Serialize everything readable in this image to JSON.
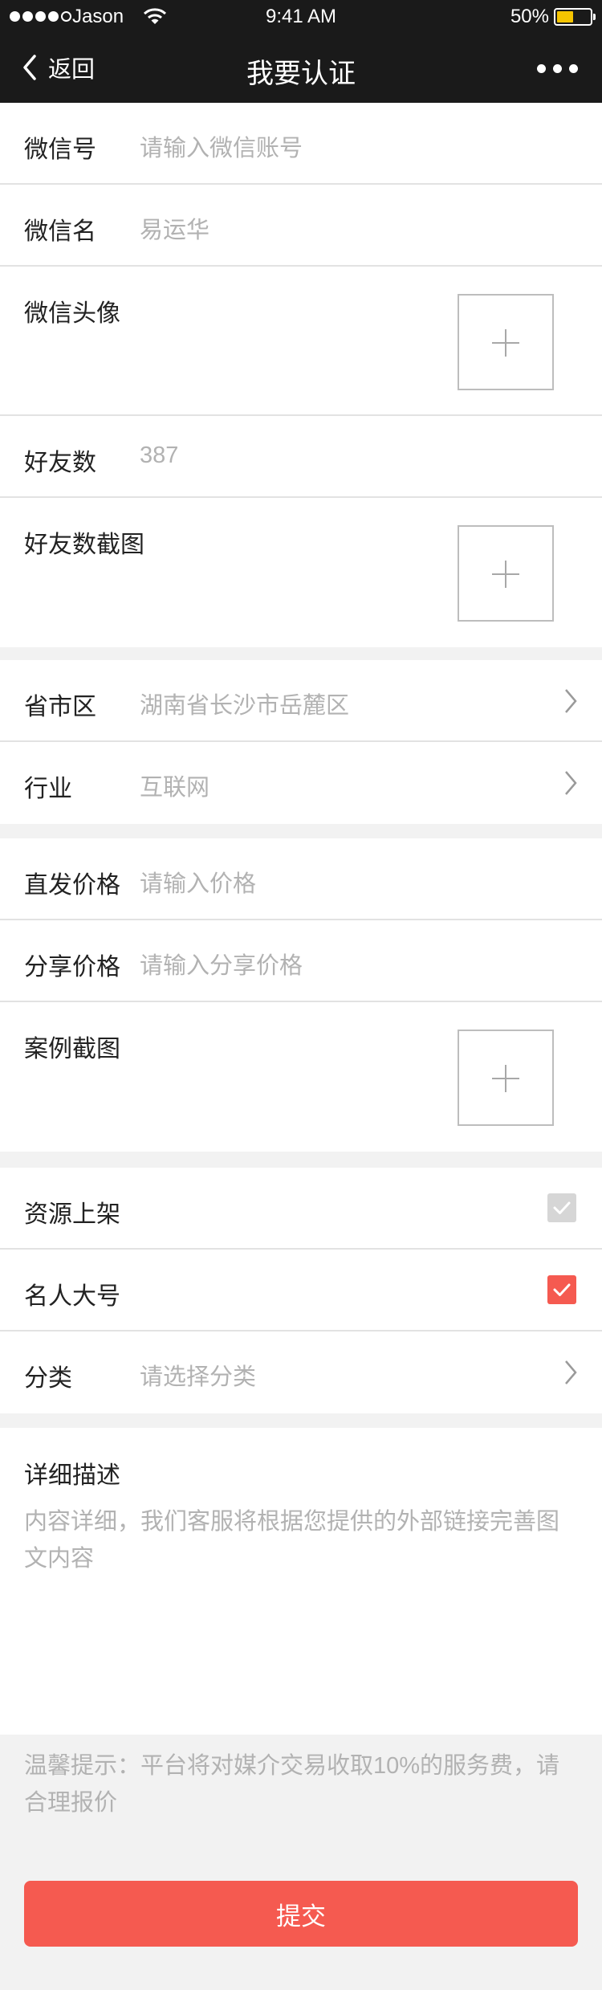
{
  "status_bar": {
    "carrier": "Jason",
    "time": "9:41 AM",
    "battery_pct": "50%",
    "battery_level": 0.5,
    "battery_color": "#f5c400",
    "signal_icons": [
      "signal-dot-icon",
      "wifi-icon",
      "battery-icon"
    ]
  },
  "nav": {
    "back_label": "返回",
    "title": "我要认证",
    "icons": [
      "chevron-left-icon",
      "more-icon"
    ]
  },
  "form": {
    "wechat_id": {
      "label": "微信号",
      "placeholder": "请输入微信账号"
    },
    "wechat_name": {
      "label": "微信名",
      "value": "易运华"
    },
    "wechat_avatar": {
      "label": "微信头像",
      "icon": "plus-icon"
    },
    "friends_count": {
      "label": "好友数",
      "value": "387"
    },
    "friends_screenshot": {
      "label": "好友数截图",
      "icon": "plus-icon"
    },
    "region": {
      "label": "省市区",
      "value": "湖南省长沙市岳麓区",
      "icon": "chevron-right-icon"
    },
    "industry": {
      "label": "行业",
      "value": "互联网",
      "icon": "chevron-right-icon"
    },
    "direct_price": {
      "label": "直发价格",
      "placeholder": "请输入价格"
    },
    "share_price": {
      "label": "分享价格",
      "placeholder": "请输入分享价格"
    },
    "case_screenshot": {
      "label": "案例截图",
      "icon": "plus-icon"
    },
    "resource_listing": {
      "label": "资源上架",
      "checked": true,
      "color": "#d6d6d6"
    },
    "celebrity": {
      "label": "名人大号",
      "checked": true,
      "color": "#f55a50"
    },
    "category": {
      "label": "分类",
      "placeholder": "请选择分类",
      "icon": "chevron-right-icon"
    },
    "description": {
      "label": "详细描述",
      "placeholder": "内容详细，我们客服将根据您提供的外部链接完善图文内容"
    }
  },
  "tip": "温馨提示：平台将对媒介交易收取10%的服务费，请合理报价",
  "submit_label": "提交",
  "colors": {
    "accent": "#f55a50",
    "nav_bg": "#1a1a1a",
    "page_bg": "#f2f2f2",
    "placeholder": "#b2b2b2"
  }
}
